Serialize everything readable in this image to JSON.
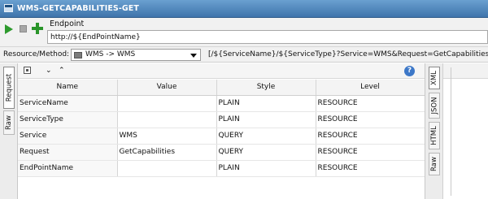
{
  "window": {
    "title": "WMS-GETCAPABILITIES-GET"
  },
  "toolbar": {
    "endpoint_label": "Endpoint",
    "endpoint_value": "http://${EndPointName}"
  },
  "resource": {
    "label": "Resource/Method:",
    "selected": "WMS -> WMS",
    "path": "[/${ServiceName}/${ServiceType}?Service=WMS&Request=GetCapabilities]"
  },
  "left_tabs": [
    {
      "label": "Request",
      "active": true
    },
    {
      "label": "Raw",
      "active": false
    }
  ],
  "params": {
    "columns": [
      "Name",
      "Value",
      "Style",
      "Level"
    ],
    "rows": [
      {
        "name": "ServiceName",
        "value": "",
        "style": "PLAIN",
        "level": "RESOURCE"
      },
      {
        "name": "ServiceType",
        "value": "",
        "style": "PLAIN",
        "level": "RESOURCE"
      },
      {
        "name": "Service",
        "value": "WMS",
        "style": "QUERY",
        "level": "RESOURCE"
      },
      {
        "name": "Request",
        "value": "GetCapabilities",
        "style": "QUERY",
        "level": "RESOURCE"
      },
      {
        "name": "EndPointName",
        "value": "",
        "style": "PLAIN",
        "level": "RESOURCE"
      }
    ]
  },
  "right_tabs": [
    {
      "label": "XML",
      "active": true
    },
    {
      "label": "JSON",
      "active": false
    },
    {
      "label": "HTML",
      "active": false
    },
    {
      "label": "Raw",
      "active": false
    }
  ],
  "help": {
    "glyph": "?"
  },
  "icons": {
    "expand": "expand-all-icon",
    "down": "chevron-down-icon",
    "up": "chevron-up-icon",
    "play": "play-icon",
    "stop": "stop-icon",
    "add": "add-icon",
    "help": "help-icon"
  },
  "glyphs": {
    "down": "⌄",
    "up": "⌃"
  },
  "colors": {
    "title_bar": "#3f74ab",
    "run_green": "#2d9a2d",
    "help_blue": "#3d78c8"
  }
}
